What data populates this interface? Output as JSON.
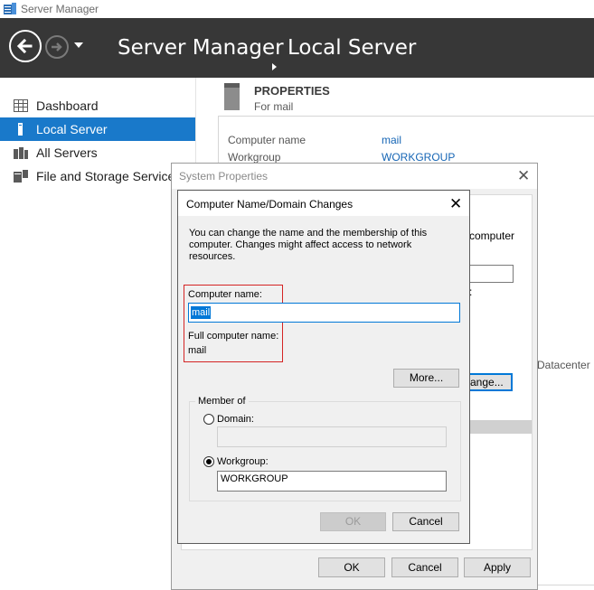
{
  "window": {
    "title": "Server Manager",
    "app_icon": "server-manager-icon"
  },
  "header": {
    "breadcrumb_root": "Server Manager",
    "breadcrumb_current": "Local Server",
    "background": "#373737"
  },
  "sidebar": {
    "items": [
      {
        "label": "Dashboard",
        "icon": "dashboard-icon",
        "selected": false
      },
      {
        "label": "Local Server",
        "icon": "local-server-icon",
        "selected": true
      },
      {
        "label": "All Servers",
        "icon": "all-servers-icon",
        "selected": false
      },
      {
        "label": "File and Storage Services",
        "icon": "file-storage-icon",
        "selected": false
      }
    ],
    "selected_color": "#1979ca"
  },
  "properties": {
    "title": "PROPERTIES",
    "subtitle": "For mail",
    "rows": [
      {
        "label": "Computer name",
        "value": "mail"
      },
      {
        "label": "Workgroup",
        "value": "WORKGROUP"
      }
    ],
    "partial_text": "Datacenter"
  },
  "system_properties": {
    "title": "System Properties",
    "fragments": {
      "computer": "computer",
      "colon": ":",
      "change": "ange..."
    },
    "buttons": {
      "ok": "OK",
      "cancel": "Cancel",
      "apply": "Apply"
    }
  },
  "dialog": {
    "title": "Computer Name/Domain Changes",
    "description": "You can change the name and the membership of this computer. Changes might affect access to network resources.",
    "computer_name_label": "Computer name:",
    "computer_name_value": "mail",
    "full_name_label": "Full computer name:",
    "full_name_value": "mail",
    "more_button": "More...",
    "member_of": {
      "legend": "Member of",
      "domain_label": "Domain:",
      "domain_value": "",
      "workgroup_label": "Workgroup:",
      "workgroup_value": "WORKGROUP",
      "selected": "workgroup"
    },
    "ok_button": "OK",
    "cancel_button": "Cancel",
    "highlight_color": "#d42424"
  }
}
